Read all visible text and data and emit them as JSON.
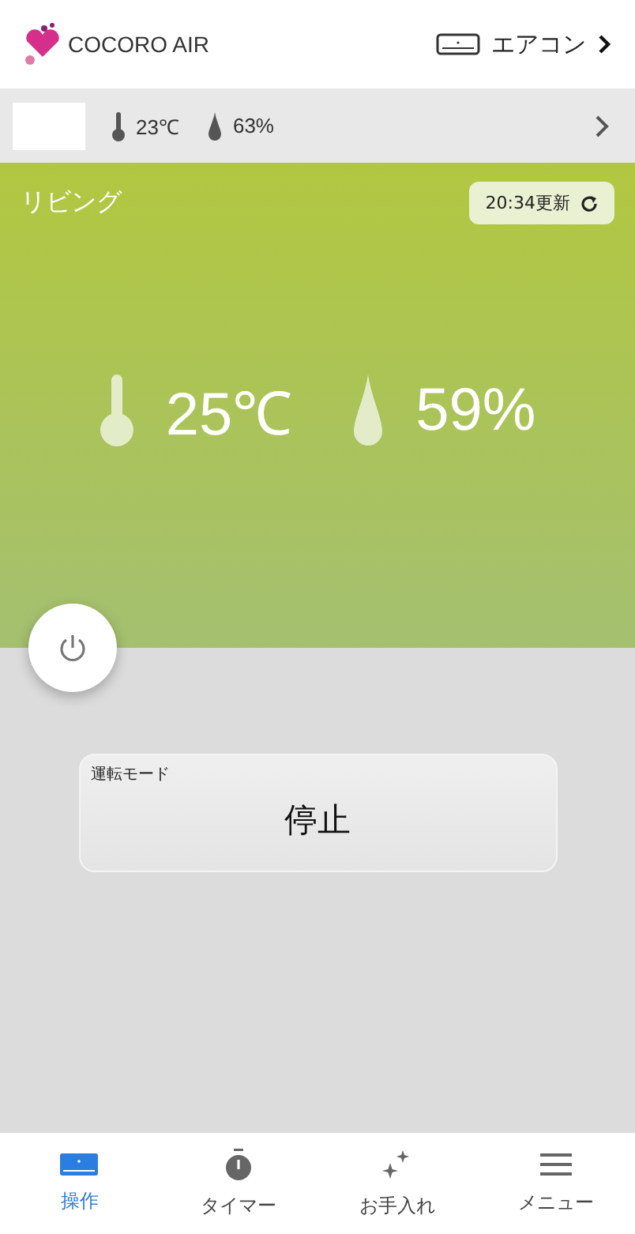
{
  "header": {
    "logo_text": "COCORO AIR",
    "device_label": "エアコン"
  },
  "outdoor": {
    "temperature": "23℃",
    "humidity": "63%"
  },
  "room": {
    "name": "リビング",
    "updated": "20:34更新",
    "temperature": "25℃",
    "humidity": "59%"
  },
  "power": {
    "on": false
  },
  "mode": {
    "label": "運転モード",
    "value": "停止"
  },
  "tabs": [
    {
      "kind": "control",
      "label": "操作",
      "selected": true
    },
    {
      "kind": "timer",
      "label": "タイマー",
      "selected": false
    },
    {
      "kind": "care",
      "label": "お手入れ",
      "selected": false
    },
    {
      "kind": "menu",
      "label": "メニュー",
      "selected": false
    }
  ]
}
